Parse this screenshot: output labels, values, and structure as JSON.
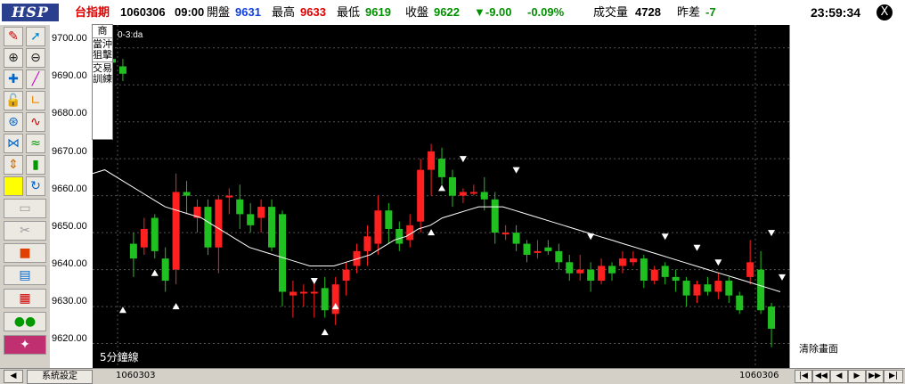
{
  "header": {
    "logo": "HSP",
    "symbol": "台指期",
    "date": "1060306",
    "time": "09:00",
    "open_label": "開盤",
    "open_value": "9631",
    "high_label": "最高",
    "high_value": "9633",
    "low_label": "最低",
    "low_value": "9619",
    "close_label": "收盤",
    "close_value": "9622",
    "change": "▼-9.00",
    "change_pct": "-0.09%",
    "volume_label": "成交量",
    "volume_value": "4728",
    "diff_label": "昨差",
    "diff_value": "-7",
    "clock": "23:59:34",
    "close_icon": "X"
  },
  "side_menu": [
    "商",
    "當沖狙擊",
    "交易訓練"
  ],
  "chart_label": "0-3:da",
  "chart_footer": "5分鐘線",
  "yaxis_labels": [
    "9700.00",
    "9690.00",
    "9680.00",
    "9670.00",
    "9660.00",
    "9650.00",
    "9640.00",
    "9630.00",
    "9620.00"
  ],
  "clear_button": "清除畫面",
  "bottom": {
    "system_button": "系統設定",
    "date_left": "1060303",
    "date_right": "1060306",
    "nav": [
      "|◀",
      "◀◀",
      "◀",
      "▶",
      "▶▶",
      "▶|"
    ]
  },
  "chart_data": {
    "type": "candlestick",
    "ylim": [
      9617,
      9705
    ],
    "ma_line": [
      9666,
      9667,
      9665,
      9663,
      9661,
      9659,
      9657,
      9656,
      9655,
      9654,
      9652,
      9650,
      9648,
      9646,
      9645,
      9644,
      9643,
      9642,
      9641,
      9641,
      9641,
      9642,
      9643,
      9644,
      9646,
      9648,
      9649,
      9651,
      9652,
      9654,
      9655,
      9656,
      9657,
      9657,
      9657,
      9656,
      9655,
      9654,
      9653,
      9652,
      9651,
      9650,
      9649,
      9648,
      9647,
      9646,
      9645,
      9644,
      9643,
      9642,
      9641,
      9640,
      9639,
      9638,
      9637,
      9636,
      9635,
      9634
    ],
    "candles": [
      [
        9697,
        9696,
        9698,
        9692
      ],
      [
        9695,
        9693,
        9697,
        9691
      ],
      [
        9647,
        9643,
        9650,
        9638
      ],
      [
        9646,
        9651,
        9654,
        9644
      ],
      [
        9654,
        9645,
        9655,
        9643
      ],
      [
        9643,
        9637,
        9646,
        9634
      ],
      [
        9640,
        9661,
        9666,
        9636
      ],
      [
        9661,
        9660,
        9664,
        9655
      ],
      [
        9654,
        9657,
        9659,
        9650
      ],
      [
        9657,
        9646,
        9659,
        9644
      ],
      [
        9646,
        9659,
        9660,
        9639
      ],
      [
        9660,
        9660,
        9662,
        9655
      ],
      [
        9659,
        9655,
        9663,
        9651
      ],
      [
        9655,
        9652,
        9658,
        9650
      ],
      [
        9654,
        9657,
        9659,
        9650
      ],
      [
        9657,
        9646,
        9659,
        9645
      ],
      [
        9655,
        9634,
        9656,
        9630
      ],
      [
        9633,
        9634,
        9637,
        9627
      ],
      [
        9634,
        9634,
        9636,
        9630
      ],
      [
        9634,
        9634,
        9637,
        9627
      ],
      [
        9635,
        9629,
        9638,
        9627
      ],
      [
        9628,
        9636,
        9638,
        9625
      ],
      [
        9637,
        9640,
        9642,
        9633
      ],
      [
        9641,
        9645,
        9647,
        9639
      ],
      [
        9645,
        9649,
        9652,
        9641
      ],
      [
        9647,
        9656,
        9660,
        9644
      ],
      [
        9656,
        9651,
        9658,
        9647
      ],
      [
        9651,
        9647,
        9653,
        9645
      ],
      [
        9648,
        9652,
        9655,
        9646
      ],
      [
        9653,
        9667,
        9670,
        9650
      ],
      [
        9667,
        9672,
        9674,
        9660
      ],
      [
        9670,
        9665,
        9673,
        9663
      ],
      [
        9665,
        9660,
        9667,
        9657
      ],
      [
        9660,
        9661,
        9662,
        9658
      ],
      [
        9661,
        9661,
        9663,
        9660
      ],
      [
        9661,
        9659,
        9665,
        9656
      ],
      [
        9659,
        9650,
        9661,
        9647
      ],
      [
        9650,
        9650,
        9652,
        9648
      ],
      [
        9650,
        9647,
        9652,
        9645
      ],
      [
        9647,
        9644,
        9648,
        9642
      ],
      [
        9645,
        9645,
        9648,
        9643
      ],
      [
        9646,
        9645,
        9648,
        9644
      ],
      [
        9645,
        9642,
        9647,
        9640
      ],
      [
        9642,
        9639,
        9644,
        9637
      ],
      [
        9639,
        9640,
        9644,
        9637
      ],
      [
        9640,
        9637,
        9642,
        9634
      ],
      [
        9637,
        9641,
        9643,
        9636
      ],
      [
        9641,
        9639,
        9642,
        9637
      ],
      [
        9641,
        9643,
        9645,
        9639
      ],
      [
        9642,
        9643,
        9645,
        9641
      ],
      [
        9643,
        9637,
        9644,
        9635
      ],
      [
        9637,
        9640,
        9641,
        9636
      ],
      [
        9641,
        9638,
        9642,
        9636
      ],
      [
        9638,
        9637,
        9640,
        9634
      ],
      [
        9637,
        9633,
        9638,
        9630
      ],
      [
        9633,
        9636,
        9637,
        9631
      ],
      [
        9636,
        9634,
        9638,
        9633
      ],
      [
        9634,
        9637,
        9639,
        9632
      ],
      [
        9637,
        9633,
        9638,
        9631
      ],
      [
        9633,
        9629,
        9634,
        9628
      ],
      [
        9638,
        9642,
        9648,
        9636
      ],
      [
        9640,
        9629,
        9645,
        9628
      ],
      [
        9630,
        9624,
        9631,
        9619
      ]
    ]
  }
}
